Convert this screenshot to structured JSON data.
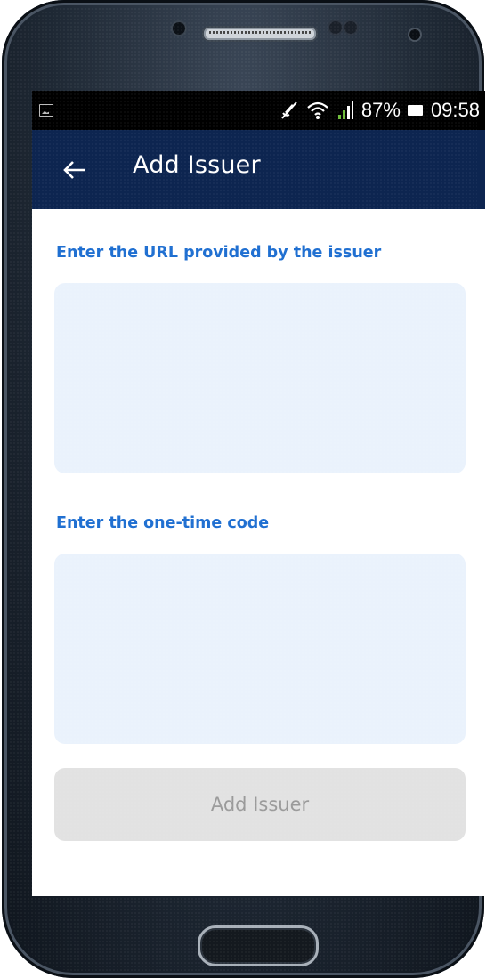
{
  "status_bar": {
    "battery_percent": "87%",
    "time": "09:58",
    "icons": [
      "gallery-notification-icon",
      "mute-icon",
      "wifi-icon",
      "signal-icon",
      "battery-icon"
    ]
  },
  "app_bar": {
    "title": "Add Issuer",
    "back_icon": "arrow-left-icon",
    "background": "#0d2550"
  },
  "form": {
    "url_label": "Enter the URL provided by the issuer",
    "url_value": "",
    "code_label": "Enter the one-time code",
    "code_value": "",
    "submit_label": "Add Issuer",
    "submit_enabled": false
  },
  "colors": {
    "accent": "#1f6fd1",
    "field_bg": "#eaf2fc",
    "button_disabled_bg": "#e2e2e2",
    "button_disabled_text": "#9a9a9a"
  }
}
